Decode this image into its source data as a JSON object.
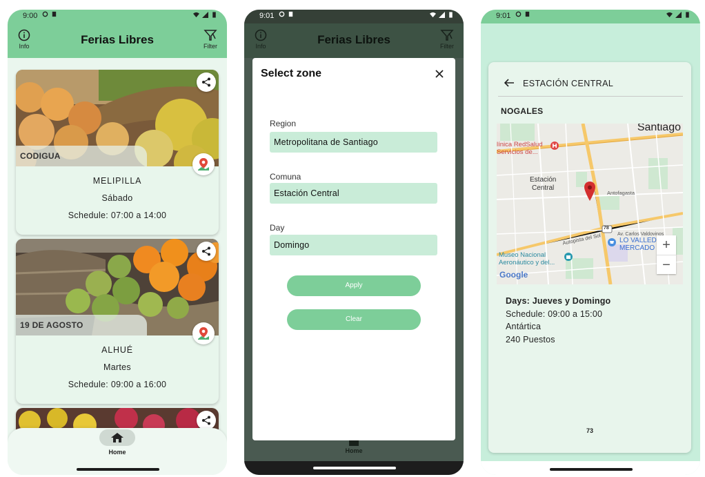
{
  "status": {
    "phone1_time": "9:00",
    "phone2_time": "9:01",
    "phone3_time": "9:01"
  },
  "appbar": {
    "title": "Ferias Libres",
    "info_label": "Info",
    "filter_label": "Filter"
  },
  "feed": {
    "cards": [
      {
        "label": "CODIGUA",
        "name": "MELIPILLA",
        "day": "Sábado",
        "schedule": "Schedule: 07:00 a 14:00"
      },
      {
        "label": "19 DE AGOSTO",
        "name": "ALHUÉ",
        "day": "Martes",
        "schedule": "Schedule: 09:00 a 16:00"
      }
    ]
  },
  "nav": {
    "home_label": "Home"
  },
  "dialog": {
    "title": "Select zone",
    "region_label": "Region",
    "region_value": "Metropolitana de Santiago",
    "comuna_label": "Comuna",
    "comuna_value": "Estación Central",
    "day_label": "Day",
    "day_value": "Domingo",
    "apply_label": "Apply",
    "clear_label": "Clear"
  },
  "detail": {
    "title": "ESTACIÓN CENTRAL",
    "subtitle": "NOGALES",
    "days": "Days: Jueves y Domingo",
    "schedule": "Schedule: 09:00 a 15:00",
    "street": "Antártica",
    "stalls": "240 Puestos",
    "count": "73",
    "map": {
      "city_label": "Santiago",
      "area_label_1": "Estación",
      "area_label_2": "Central",
      "clinic_1": "línica RedSalud",
      "clinic_2": "Servicios de...",
      "street_1": "Antofagasta",
      "street_2": "Autopista del Sol",
      "street_3": "Av. Carlos Valdovinos",
      "shop_1": "LO VALLEDOR",
      "shop_2": "MERCADO",
      "museum_1": "Museo Nacional",
      "museum_2": "Aeronáutico y del...",
      "route": "78",
      "brand": "Google",
      "zoom_in": "+",
      "zoom_out": "−"
    }
  },
  "colors": {
    "primary": "#7dce99",
    "surface": "#e8f6ec",
    "field": "#c9ecd8",
    "marker": "#d32f2f"
  }
}
